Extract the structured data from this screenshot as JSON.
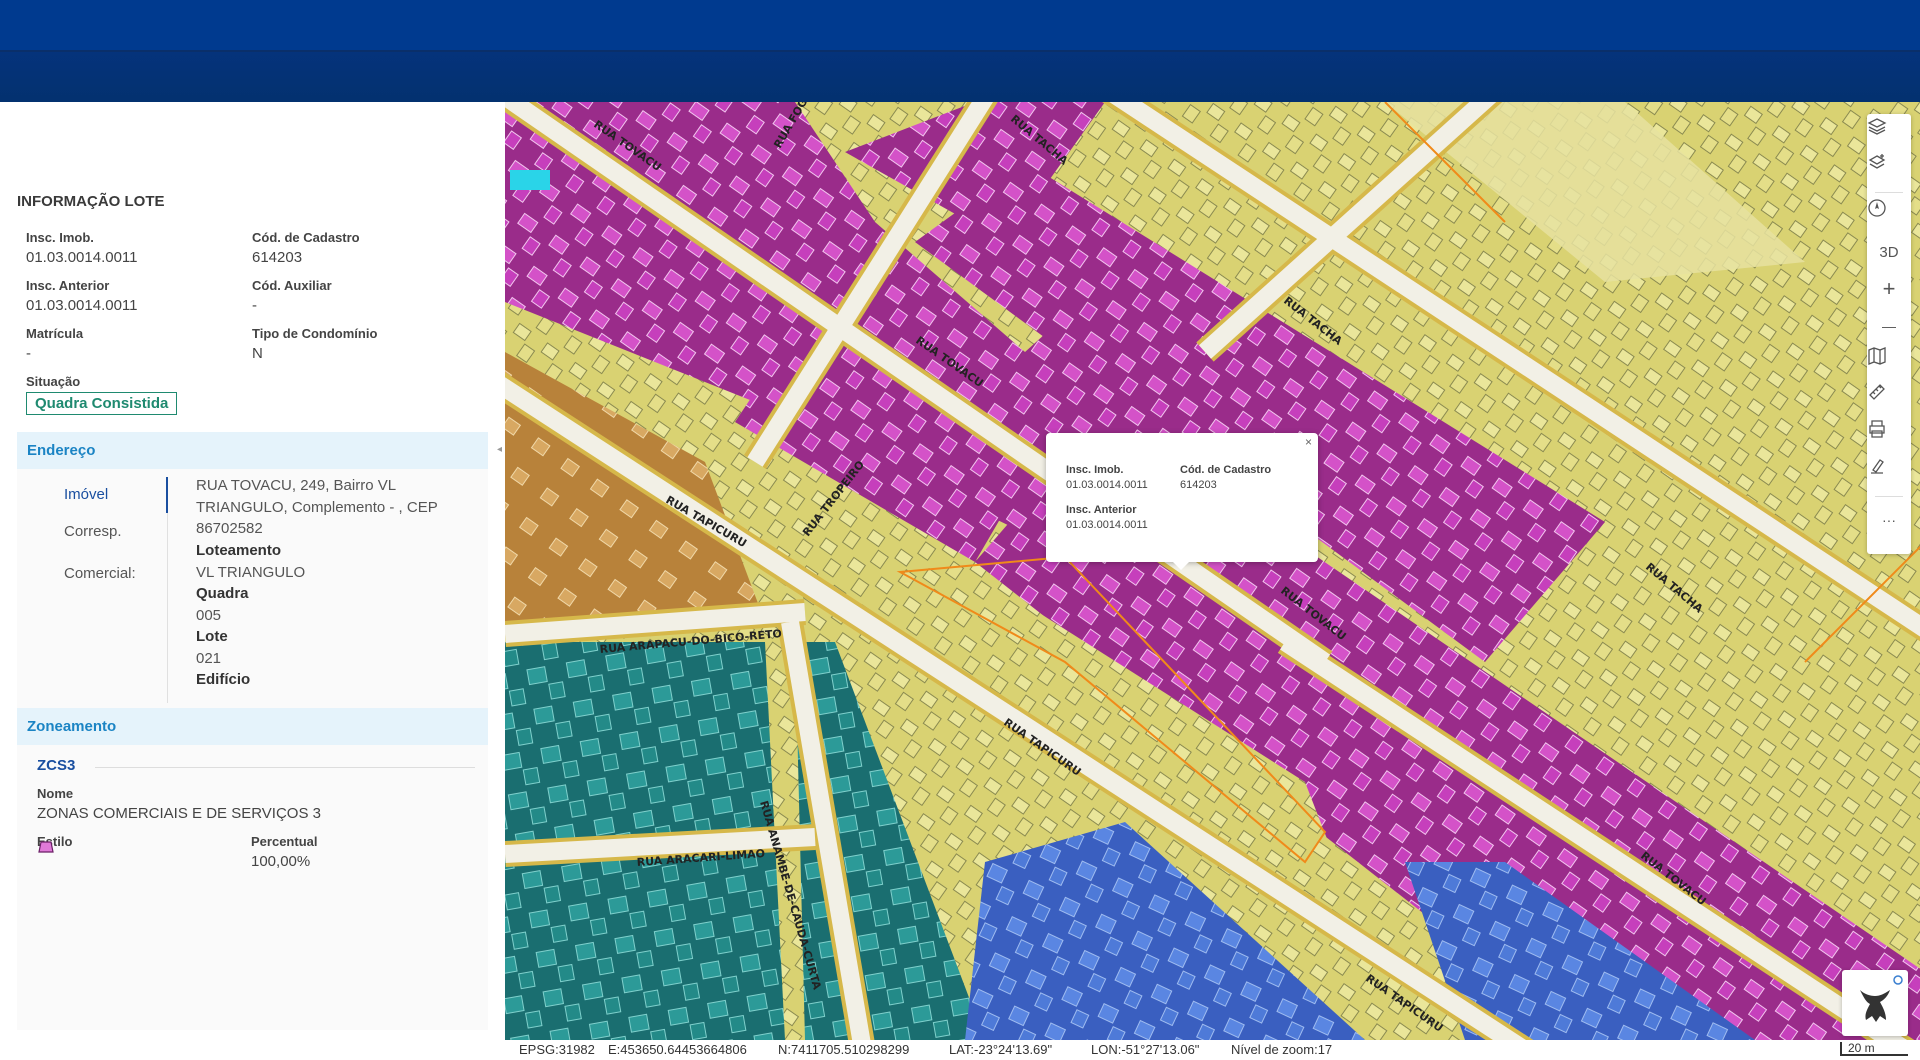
{
  "panel": {
    "title": "INFORMAÇÃO LOTE",
    "fields": {
      "insc_imob_label": "Insc. Imob.",
      "insc_imob_value": "01.03.0014.0011",
      "cod_cadastro_label": "Cód. de Cadastro",
      "cod_cadastro_value": "614203",
      "insc_anterior_label": "Insc. Anterior",
      "insc_anterior_value": "01.03.0014.0011",
      "cod_auxiliar_label": "Cód. Auxiliar",
      "cod_auxiliar_value": "-",
      "matricula_label": "Matrícula",
      "matricula_value": "-",
      "tipo_condominio_label": "Tipo de Condomínio",
      "tipo_condominio_value": "N",
      "situacao_label": "Situação",
      "situacao_value": "Quadra Consistida"
    },
    "endereco": {
      "header": "Endereço",
      "tabs": [
        "Imóvel",
        "Corresp.",
        "Comercial:"
      ],
      "address": "RUA TOVACU, 249, Bairro VL TRIANGULO, Complemento - , CEP 86702582",
      "loteamento_label": "Loteamento",
      "loteamento_value": "VL TRIANGULO",
      "quadra_label": "Quadra",
      "quadra_value": "005",
      "lote_label": "Lote",
      "lote_value": "021",
      "edificio_label": "Edifício"
    },
    "zoneamento": {
      "header": "Zoneamento",
      "code": "ZCS3",
      "nome_label": "Nome",
      "nome_value": "ZONAS COMERCIAIS E DE SERVIÇOS 3",
      "estilo_label": "Estilo",
      "estilo_color": "#e07ad8",
      "percentual_label": "Percentual",
      "percentual_value": "100,00%"
    }
  },
  "map": {
    "street_labels": [
      "RUA TOVACU",
      "RUA FOGO-A",
      "RUA TACHA",
      "RUA TACHA",
      "RUA TOVACU",
      "RUA TROPEIRO",
      "RUA TAPICURU",
      "RUA TOVACU",
      "RUA TACHA",
      "RUA ARAPACU-DO-BICO-RETO",
      "RUA TAPICURU",
      "RUA ARACARI-LIMAO",
      "RUA ANAMBE-DE-CAUDA-CURTA",
      "RUA TOVACU",
      "RUA TAPICURU"
    ],
    "popup": {
      "close": "×",
      "insc_imob_label": "Insc. Imob.",
      "insc_imob_value": "01.03.0014.0011",
      "cod_cadastro_label": "Cód. de Cadastro",
      "cod_cadastro_value": "614203",
      "insc_anterior_label": "Insc. Anterior",
      "insc_anterior_value": "01.03.0014.0011"
    },
    "toolbar": {
      "threed_label": "3D",
      "plus": "+",
      "minus": "—",
      "more": "···"
    },
    "icons": [
      "layers-icon",
      "layers-add-icon",
      "compass-icon",
      "map-icon",
      "ruler-icon",
      "print-icon",
      "draw-icon",
      "bird-logo-icon"
    ],
    "zone_colors": {
      "commercial": "#c43fbf",
      "residential": "#e8e07a",
      "industrial": "#1e8a8c",
      "blue_zone": "#4a77d8",
      "road": "#f0eee4",
      "road_border": "#d6b84a",
      "selected_outline": "#f08a1a"
    }
  },
  "status": {
    "epsg": "EPSG:31982",
    "easting": "E:453650.64453664806",
    "northing": "N:7411705.510298299",
    "lat": "LAT:-23°24'13.69\"",
    "lon": "LON:-51°27'13.06\"",
    "zoom": "Nível de zoom:17",
    "scale": "20 m"
  }
}
